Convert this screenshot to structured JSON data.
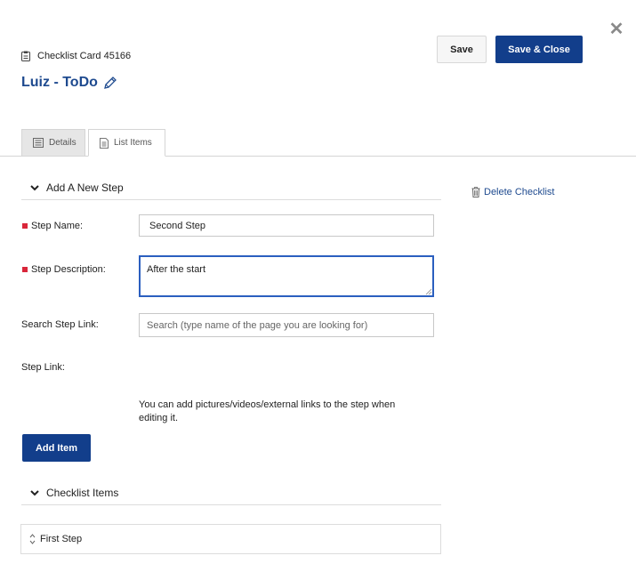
{
  "header": {
    "card_label": "Checklist Card 45166",
    "title": "Luiz - ToDo",
    "save_label": "Save",
    "save_close_label": "Save & Close"
  },
  "tabs": [
    {
      "label": "Details",
      "icon": "details-icon",
      "active": false
    },
    {
      "label": "List Items",
      "icon": "list-icon",
      "active": true
    }
  ],
  "new_step": {
    "section_title": "Add A New Step",
    "step_name_label": "Step Name:",
    "step_name_value": "Second Step",
    "step_description_label": "Step Description:",
    "step_description_value": "After the start",
    "search_link_label": "Search Step Link:",
    "search_link_placeholder": "Search (type name of the page you are looking for)",
    "step_link_label": "Step Link:",
    "hint": "You can add pictures/videos/external links to the step when editing it.",
    "add_button_label": "Add Item"
  },
  "delete_checklist_label": "Delete Checklist",
  "checklist_items": {
    "section_title": "Checklist Items",
    "items": [
      "First Step"
    ]
  },
  "colors": {
    "primary": "#123e8b",
    "link": "#1e4a8f",
    "required": "#d9263a"
  }
}
